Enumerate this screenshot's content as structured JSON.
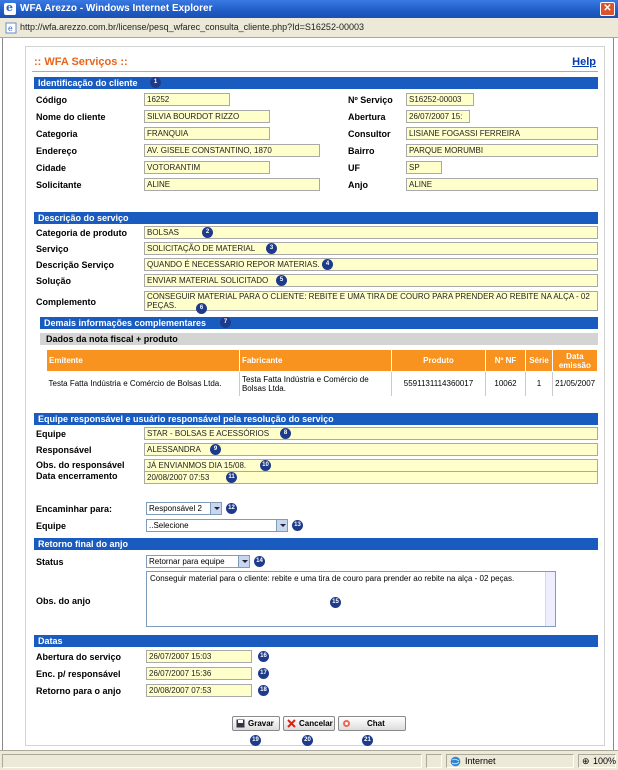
{
  "window": {
    "title": "WFA Arezzo - Windows Internet Explorer",
    "url": "http://wfa.arezzo.com.br/license/pesq_wfarec_consulta_cliente.php?Id=S16252-00003"
  },
  "page": {
    "title": ":: WFA Serviços ::",
    "help": "Help"
  },
  "sections": {
    "identificacao": "Identificação do cliente",
    "descricao": "Descrição do serviço",
    "demais": "Demais informações complementares",
    "equipe": "Equipe responsável e usuário responsável pela resolução do serviço",
    "retorno": "Retorno final do anjo",
    "datas": "Datas"
  },
  "cliente": {
    "codigo_label": "Código",
    "codigo": "16252",
    "nservico_label": "Nº Serviço",
    "nservico": "S16252-00003",
    "nome_label": "Nome do cliente",
    "nome": "SILVIA BOURDOT RIZZO",
    "abertura_label": "Abertura",
    "abertura": "26/07/2007 15:",
    "categoria_label": "Categoria",
    "categoria": "FRANQUIA",
    "consultor_label": "Consultor",
    "consultor": "LISIANE FOGASSI FERREIRA",
    "endereco_label": "Endereço",
    "endereco": "AV. GISELE CONSTANTINO, 1870",
    "bairro_label": "Bairro",
    "bairro": "PARQUE MORUMBI",
    "cidade_label": "Cidade",
    "cidade": "VOTORANTIM",
    "uf_label": "UF",
    "uf": "SP",
    "solicitante_label": "Solicitante",
    "solicitante": "ALINE",
    "anjo_label": "Anjo",
    "anjo": "ALINE"
  },
  "servico": {
    "catprod_label": "Categoria de produto",
    "catprod": "BOLSAS",
    "servico_label": "Serviço",
    "servico": "SOLICITAÇÃO DE MATERIAL",
    "descricao_label": "Descrição Serviço",
    "descricao": "QUANDO É NECESSARIO REPOR MATERIAS.",
    "solucao_label": "Solução",
    "solucao": "ENVIAR MATERIAL SOLICITADO",
    "complemento_label": "Complemento",
    "complemento": "CONSEGUIR MATERIAL PARA O CLIENTE: REBITE E UMA TIRA DE COURO PARA PRENDER AO REBITE NA ALÇA - 02 PEÇAS."
  },
  "nota": {
    "subhead": "Dados da nota fiscal + produto",
    "headers": [
      "Emitente",
      "Fabricante",
      "Produto",
      "Nº NF",
      "Série",
      "Data emissão"
    ],
    "row": [
      "Testa Fatta Indústria e Comércio de Bolsas Ltda.",
      "Testa Fatta Indústria e Comércio de Bolsas Ltda.",
      "5591131114360017",
      "10062",
      "1",
      "21/05/2007"
    ]
  },
  "equipe": {
    "equipe_label": "Equipe",
    "equipe": "STAR - BOLSAS E ACESSÓRIOS",
    "resp_label": "Responsável",
    "resp": "ALESSANDRA",
    "obs_label": "Obs. do responsável",
    "obs": "JÁ ENVIANMOS DIA 15/08.",
    "dataenc_label": "Data encerramento",
    "dataenc": "20/08/2007 07:53",
    "encaminhar_label": "Encaminhar para:",
    "encaminhar": "Responsável 2",
    "equipe2_label": "Equipe",
    "equipe2": "..Selecione"
  },
  "retorno": {
    "status_label": "Status",
    "status": "Retornar para equipe",
    "obs_label": "Obs. do anjo",
    "obs": "Conseguir material para o cliente: rebite e uma tira de couro para prender ao rebite na alça - 02 peças."
  },
  "datas": {
    "abertura_label": "Abertura do serviço",
    "abertura": "26/07/2007 15:03",
    "enc_label": "Enc. p/ responsável",
    "enc": "26/07/2007 15:36",
    "retorno_label": "Retorno para o anjo",
    "retorno": "20/08/2007 07:53"
  },
  "buttons": {
    "gravar": "Gravar",
    "cancelar": "Cancelar",
    "chat": "Chat"
  },
  "badges": [
    "1",
    "2",
    "3",
    "4",
    "5",
    "6",
    "7",
    "8",
    "9",
    "10",
    "11",
    "12",
    "13",
    "14",
    "15",
    "16",
    "17",
    "18",
    "19",
    "20",
    "21"
  ],
  "statusbar": {
    "zone": "Internet",
    "zoom": "100%"
  },
  "colors": {
    "section": "#1a5bbf",
    "field": "#ffffcc",
    "table_header": "#f7931e",
    "title": "#e8641b"
  }
}
